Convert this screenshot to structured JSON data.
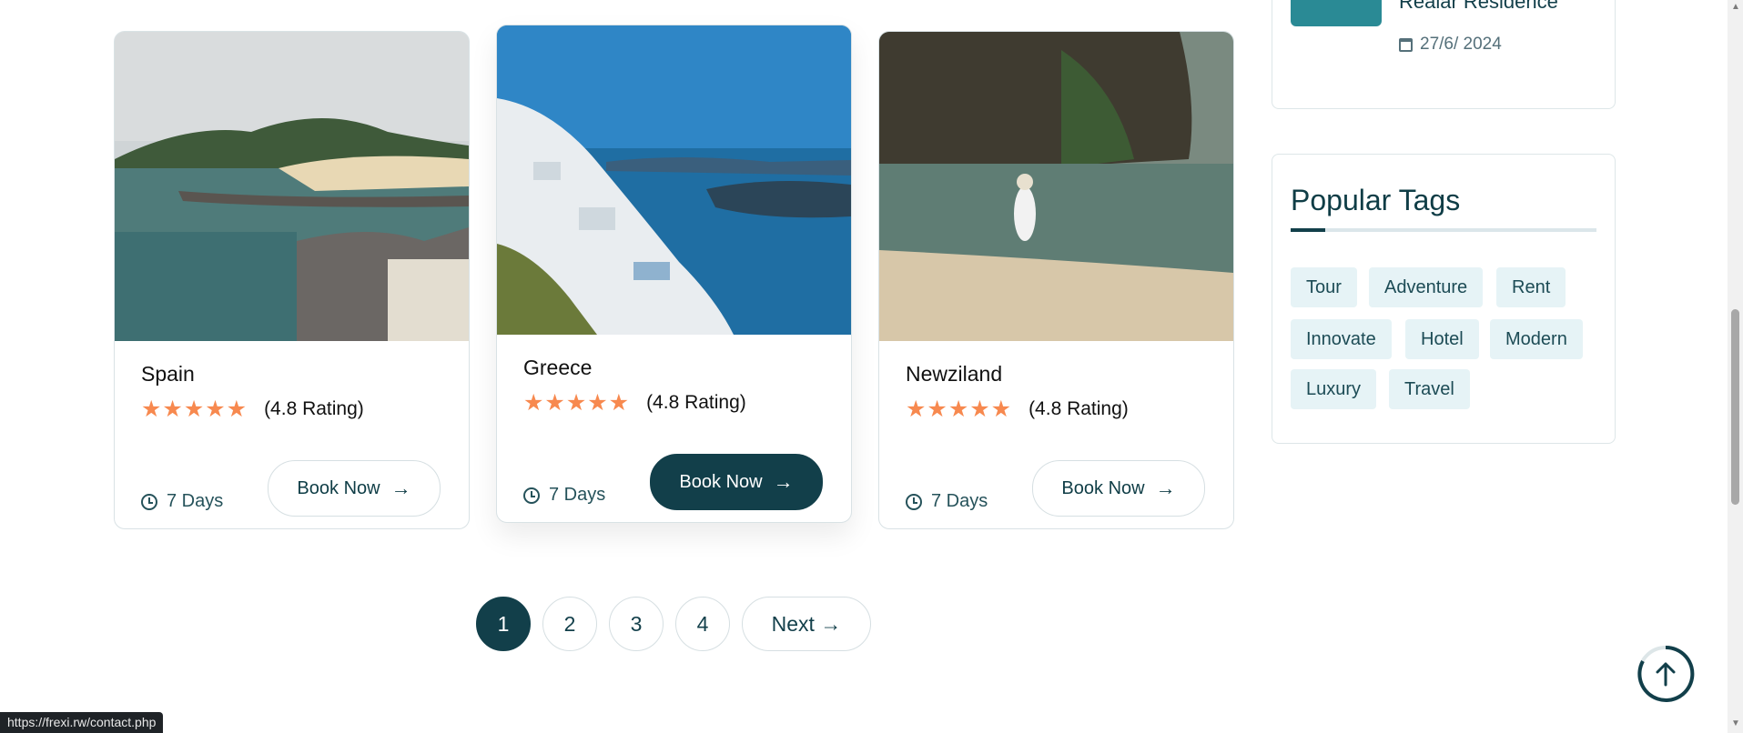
{
  "cards": [
    {
      "title": "Spain",
      "stars": "★★★★★",
      "rating": "(4.8 Rating)",
      "days": "7 Days",
      "book_label": "Book Now",
      "arrow": "→"
    },
    {
      "title": "Greece",
      "stars": "★★★★★",
      "rating": "(4.8 Rating)",
      "days": "7 Days",
      "book_label": "Book Now",
      "arrow": "→"
    },
    {
      "title": "Newziland",
      "stars": "★★★★★",
      "rating": "(4.8 Rating)",
      "days": "7 Days",
      "book_label": "Book Now",
      "arrow": "→"
    }
  ],
  "recent_post": {
    "title": "Realar Residence",
    "date": "27/6/ 2024"
  },
  "popular_tags": {
    "title": "Popular Tags",
    "tags": [
      "Tour",
      "Adventure",
      "Rent",
      "Innovate",
      "Hotel",
      "Modern",
      "Luxury",
      "Travel"
    ]
  },
  "pagination": {
    "pages": [
      "1",
      "2",
      "3",
      "4"
    ],
    "active": "1",
    "next_label": "Next →"
  },
  "status_url": "https://frexi.rw/contact.php",
  "colors": {
    "primary": "#123f4a",
    "star": "#f7894f",
    "tag_bg": "#e6f3f6"
  },
  "icons": {
    "clock": "clock-icon",
    "calendar": "calendar-icon",
    "arrow": "arrow-right-icon",
    "back_to_top": "arrow-up-icon"
  }
}
